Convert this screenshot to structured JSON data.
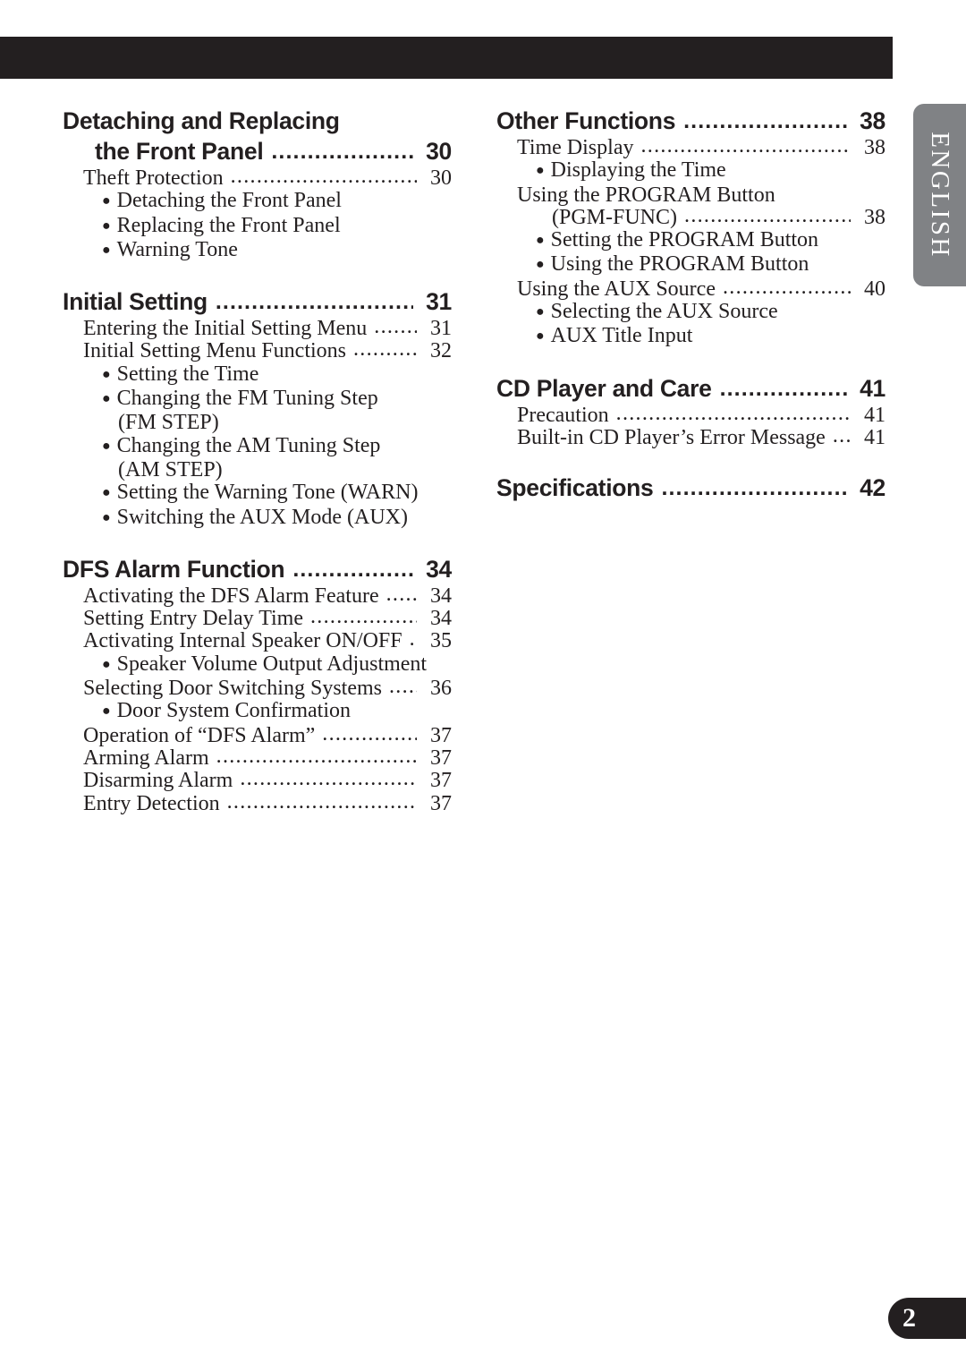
{
  "page": {
    "number": "2",
    "language_tab": "ENGLISH",
    "accent_dark": "#231f20",
    "tab_gray": "#808285"
  },
  "left_column": [
    {
      "heading": {
        "line1": "Detaching and Replacing",
        "line2": "the Front Panel",
        "page": "30"
      },
      "entries": [
        {
          "kind": "entry",
          "label": "Theft Protection",
          "page": "30"
        },
        {
          "kind": "bullet",
          "label": "Detaching the Front Panel"
        },
        {
          "kind": "bullet",
          "label": "Replacing the Front Panel"
        },
        {
          "kind": "bullet",
          "label": "Warning Tone"
        }
      ]
    },
    {
      "heading": {
        "line1": "Initial Setting",
        "page": "31"
      },
      "entries": [
        {
          "kind": "entry",
          "label": "Entering the Initial Setting Menu",
          "page": "31"
        },
        {
          "kind": "entry",
          "label": "Initial Setting Menu Functions",
          "page": "32"
        },
        {
          "kind": "bullet",
          "label": "Setting the Time"
        },
        {
          "kind": "bullet",
          "label": "Changing the FM Tuning Step"
        },
        {
          "kind": "cont",
          "label": "(FM STEP)"
        },
        {
          "kind": "bullet",
          "label": "Changing the AM Tuning Step"
        },
        {
          "kind": "cont",
          "label": "(AM STEP)"
        },
        {
          "kind": "bullet",
          "label": "Setting the Warning Tone (WARN)"
        },
        {
          "kind": "bullet",
          "label": "Switching the AUX Mode (AUX)"
        }
      ]
    },
    {
      "heading": {
        "line1": "DFS Alarm Function",
        "page": "34"
      },
      "entries": [
        {
          "kind": "entry",
          "label": "Activating the DFS Alarm Feature",
          "page": "34"
        },
        {
          "kind": "entry",
          "label": "Setting Entry Delay Time",
          "page": "34"
        },
        {
          "kind": "entry",
          "label": "Activating Internal Speaker ON/OFF",
          "page": "35"
        },
        {
          "kind": "bullet",
          "label": "Speaker Volume Output Adjustment"
        },
        {
          "kind": "entry",
          "label": "Selecting Door Switching Systems",
          "page": "36"
        },
        {
          "kind": "bullet",
          "label": "Door System Confirmation"
        },
        {
          "kind": "entry",
          "label": "Operation of “DFS Alarm”",
          "page": "37"
        },
        {
          "kind": "entry",
          "label": "Arming Alarm",
          "page": "37"
        },
        {
          "kind": "entry",
          "label": "Disarming Alarm",
          "page": "37"
        },
        {
          "kind": "entry",
          "label": "Entry Detection",
          "page": "37"
        }
      ]
    }
  ],
  "right_column": [
    {
      "heading": {
        "line1": "Other Functions",
        "page": "38"
      },
      "entries": [
        {
          "kind": "entry",
          "label": "Time Display",
          "page": "38"
        },
        {
          "kind": "bullet",
          "label": "Displaying the Time"
        },
        {
          "kind": "plain",
          "label": "Using the PROGRAM Button"
        },
        {
          "kind": "cont2",
          "label": "(PGM-FUNC)",
          "page": "38"
        },
        {
          "kind": "bullet",
          "label": "Setting the PROGRAM Button"
        },
        {
          "kind": "bullet",
          "label": "Using the PROGRAM Button"
        },
        {
          "kind": "entry",
          "label": "Using the AUX Source",
          "page": "40"
        },
        {
          "kind": "bullet",
          "label": "Selecting the AUX Source"
        },
        {
          "kind": "bullet",
          "label": "AUX Title Input"
        }
      ]
    },
    {
      "heading": {
        "line1": "CD Player and Care",
        "page": "41"
      },
      "entries": [
        {
          "kind": "entry",
          "label": "Precaution",
          "page": "41"
        },
        {
          "kind": "entry",
          "label": "Built-in CD Player’s Error Message",
          "page": "41"
        }
      ]
    },
    {
      "heading": {
        "line1": "Specifications",
        "page": "42"
      },
      "entries": []
    }
  ],
  "leader": {
    "dots": "...................................................................................................."
  },
  "bullet_glyph": "●"
}
